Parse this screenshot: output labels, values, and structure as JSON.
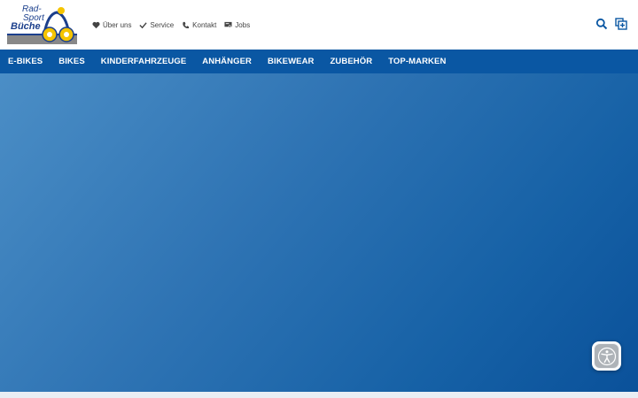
{
  "brand": {
    "logo_line1": "Rad-",
    "logo_line2": "Sport",
    "logo_line3": "Büche",
    "primary_color": "#0a57a3",
    "logo_blue": "#1b3f8c",
    "logo_yellow": "#f5c400"
  },
  "toplinks": [
    {
      "label": "Über uns",
      "icon": "heart-icon"
    },
    {
      "label": "Service",
      "icon": "check-icon"
    },
    {
      "label": "Kontakt",
      "icon": "phone-icon"
    },
    {
      "label": "Jobs",
      "icon": "jobs-board-icon"
    }
  ],
  "header_icons": [
    "search-icon",
    "compare-add-icon"
  ],
  "nav": {
    "items": [
      "E-BIKES",
      "BIKES",
      "KINDERFAHRZEUGE",
      "ANHÄNGER",
      "BIKEWEAR",
      "ZUBEHÖR",
      "TOP-MARKEN"
    ]
  },
  "accessibility": {
    "icon": "accessibility-person-icon"
  }
}
